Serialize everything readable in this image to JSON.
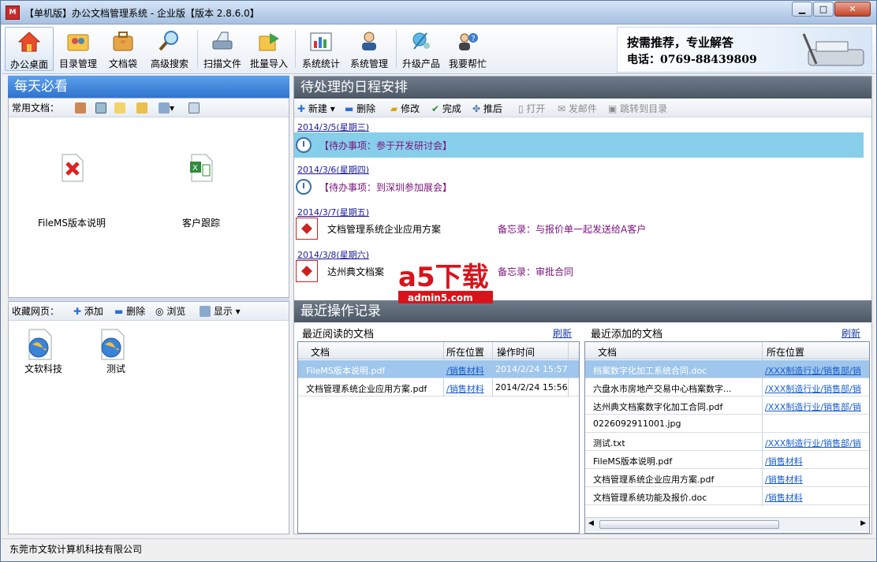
{
  "window": {
    "title": "【单机版】办公文档管理系统 - 企业版【版本 2.8.6.0】",
    "icon_label": "M",
    "min_icon": "minimize-icon",
    "max_icon": "maximize-icon",
    "close_icon": "close-icon"
  },
  "toolbar": {
    "items": [
      {
        "label": "办公桌面",
        "icon": "home-icon"
      },
      {
        "label": "目录管理",
        "icon": "folder-users-icon"
      },
      {
        "label": "文档袋",
        "icon": "bag-icon"
      },
      {
        "label": "高级搜索",
        "icon": "search-icon"
      },
      {
        "label": "扫描文件",
        "icon": "scanner-icon"
      },
      {
        "label": "批量导入",
        "icon": "import-icon"
      },
      {
        "label": "系统统计",
        "icon": "chart-icon"
      },
      {
        "label": "系统管理",
        "icon": "admin-icon"
      },
      {
        "label": "升级产品",
        "icon": "upgrade-icon"
      },
      {
        "label": "我要帮忙",
        "icon": "help-icon"
      }
    ]
  },
  "banner": {
    "line1": "按需推荐，专业解答",
    "line2": "电话：0769-88439809"
  },
  "daily": {
    "title": "每天必看",
    "common_label": "常用文档：",
    "docs": [
      {
        "name": "FileMS版本说明",
        "icon": "pdf-icon"
      },
      {
        "name": "客户跟踪",
        "icon": "excel-icon"
      }
    ]
  },
  "favorites": {
    "label": "收藏网页：",
    "add": "添加",
    "delete": "删除",
    "browse": "浏览",
    "display": "显示",
    "items": [
      {
        "name": "文软科技",
        "icon": "globe-icon"
      },
      {
        "name": "测试",
        "icon": "globe-icon"
      }
    ]
  },
  "schedule": {
    "title": "待处理的日程安排",
    "toolbar": {
      "new": "新建",
      "delete": "删除",
      "edit": "修改",
      "done": "完成",
      "postpone": "推后",
      "open": "打开",
      "send_mail": "发邮件",
      "jump": "跳转到目录"
    },
    "entries": [
      {
        "date": "2014/3/5(星期三)",
        "text": "【待办事项：参于开发研讨会】",
        "type": "todo"
      },
      {
        "date": "2014/3/6(星期四)",
        "text": "【待办事项：到深圳参加展会】",
        "type": "todo"
      },
      {
        "date": "2014/3/7(星期五)",
        "text": "文档管理系统企业应用方案",
        "memo": "备忘录：与报价单一起发送给A客户",
        "type": "doc"
      },
      {
        "date": "2014/3/8(星期六)",
        "text": "达州典文档案",
        "memo": "备忘录：审批合同",
        "type": "doc"
      }
    ]
  },
  "recent": {
    "title": "最近操作记录",
    "read": {
      "title": "最近阅读的文档",
      "refresh": "刷新",
      "columns": [
        "文档",
        "所在位置",
        "操作时间"
      ],
      "rows": [
        {
          "doc": "FileMS版本说明.pdf",
          "loc": "/销售材料",
          "time": "2014/2/24 15:57"
        },
        {
          "doc": "文档管理系统企业应用方案.pdf",
          "loc": "/销售材料",
          "time": "2014/2/24 15:56"
        }
      ]
    },
    "added": {
      "title": "最近添加的文档",
      "refresh": "刷新",
      "columns": [
        "文档",
        "所在位置"
      ],
      "rows": [
        {
          "doc": "档案数字化加工系统合同.doc",
          "loc": "/XXX制造行业/销售部/销"
        },
        {
          "doc": "六盘水市房地产交易中心档案数字...",
          "loc": "/XXX制造行业/销售部/销"
        },
        {
          "doc": "达州典文档案数字化加工合同.pdf",
          "loc": "/XXX制造行业/销售部/销"
        },
        {
          "doc": "0226092911001.jpg",
          "loc": ""
        },
        {
          "doc": "测试.txt",
          "loc": "/XXX制造行业/销售部/销"
        },
        {
          "doc": "FileMS版本说明.pdf",
          "loc": "/销售材料"
        },
        {
          "doc": "文档管理系统企业应用方案.pdf",
          "loc": "/销售材料"
        },
        {
          "doc": "文档管理系统功能及报价.doc",
          "loc": "/销售材料"
        }
      ]
    }
  },
  "status": {
    "company": "东莞市文软计算机科技有限公司"
  },
  "watermark": {
    "brand": "a5下载",
    "site": "admin5.com"
  }
}
